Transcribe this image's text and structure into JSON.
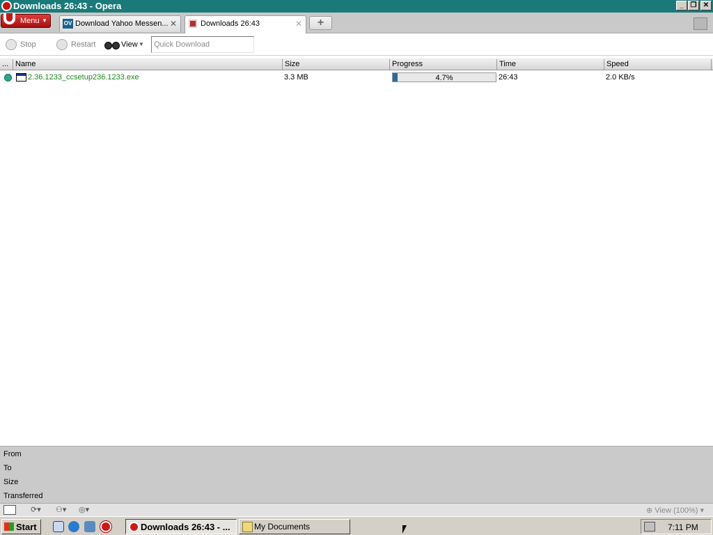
{
  "window": {
    "title": "Downloads 26:43 - Opera",
    "controls": [
      "minimize",
      "restore",
      "close"
    ]
  },
  "tabbar": {
    "menu_label": "Menu",
    "tabs": [
      {
        "label": "Download Yahoo Messen...",
        "icon": "ov-icon",
        "close": "✕",
        "active": false
      },
      {
        "label": "Downloads 26:43",
        "icon": "downloads-icon",
        "close": "✕",
        "active": true
      }
    ],
    "new_tab": "+"
  },
  "toolbar": {
    "stop_label": "Stop",
    "restart_label": "Restart",
    "view_label": "View",
    "quick_download_placeholder": "Quick Download"
  },
  "columns": {
    "menu": "...",
    "name": "Name",
    "size": "Size",
    "progress": "Progress",
    "time": "Time",
    "speed": "Speed"
  },
  "downloads": [
    {
      "name": "2.36.1233_ccsetup236.1233.exe",
      "size": "3.3 MB",
      "progress_text": "4.7%",
      "progress_fraction": 0.047,
      "time": "26:43",
      "speed": "2.0 KB/s",
      "status_color": "#2aa88c",
      "name_color": "#1a8a1a"
    }
  ],
  "details": {
    "from_label": "From",
    "to_label": "To",
    "size_label": "Size",
    "transferred_label": "Transferred"
  },
  "statusbar": {
    "zoom_label": "View (100%)"
  },
  "taskbar": {
    "start_label": "Start",
    "tasks": [
      {
        "label": "Downloads 26:43 - ...",
        "pressed": true
      },
      {
        "label": "My Documents",
        "pressed": false
      }
    ],
    "clock": "7:11 PM"
  }
}
